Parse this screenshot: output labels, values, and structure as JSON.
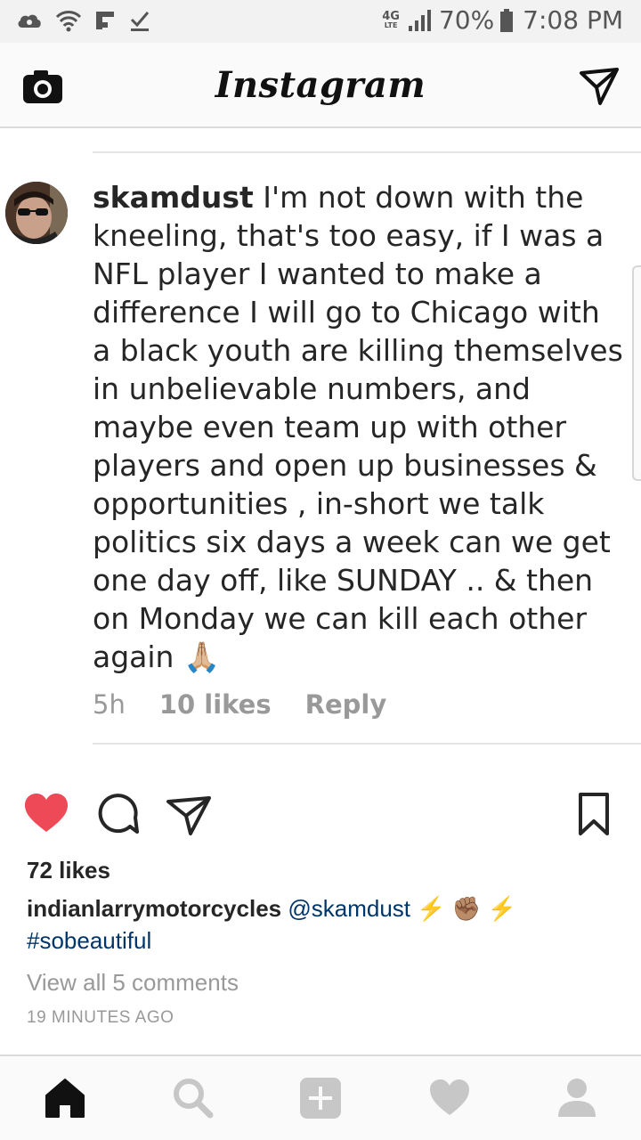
{
  "status_bar": {
    "network": "4G",
    "network_sub": "LTE",
    "battery": "70%",
    "time": "7:08 PM",
    "icons": [
      "cloud-icon",
      "wifi-icon",
      "flipboard-icon",
      "download-done-icon"
    ]
  },
  "header": {
    "logo": "Instagram",
    "left_icon": "camera-icon",
    "right_icon": "direct-message-icon"
  },
  "comment": {
    "username": "skamdust",
    "text": "I'm not down with the kneeling, that's too easy, if I was a NFL player I wanted to make a difference I will go to Chicago with a black youth are killing themselves in unbelievable numbers, and maybe even team up with other players and open up businesses & opportunities , in-short we talk politics six days a week can we get one day off, like SUNDAY .. &  then on Monday we can kill each other again",
    "emoji": "🙏🏼",
    "time": "5h",
    "likes": "10 likes",
    "reply": "Reply"
  },
  "post": {
    "liked": true,
    "likes": "72 likes",
    "caption_user": "indianlarrymotorcycles",
    "mention": "@skamdust",
    "caption_emoji": "⚡ ✊🏽 ⚡",
    "hashtag": "#sobeautiful",
    "view_all": "View all 5 comments",
    "time_ago": "19 MINUTES AGO"
  },
  "bottom_nav": {
    "items": [
      "home-icon",
      "search-icon",
      "add-post-icon",
      "activity-heart-icon",
      "profile-icon"
    ],
    "active": "home-icon"
  },
  "colors": {
    "like_red": "#ed4956",
    "link_blue": "#003569",
    "muted": "#999999"
  }
}
